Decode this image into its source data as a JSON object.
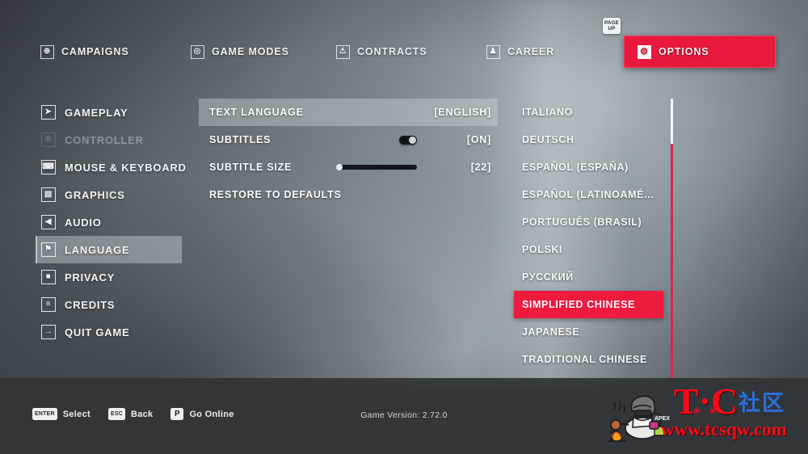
{
  "topnav": {
    "items": [
      {
        "label": "CAMPAIGNS",
        "icon": "globe-icon",
        "glyph": "⊕",
        "active": false
      },
      {
        "label": "GAME MODES",
        "icon": "target-icon",
        "glyph": "◎",
        "active": false
      },
      {
        "label": "CONTRACTS",
        "icon": "warning-icon",
        "glyph": "⚠",
        "active": false
      },
      {
        "label": "CAREER",
        "icon": "person-icon",
        "glyph": "♟",
        "active": false
      },
      {
        "label": "OPTIONS",
        "icon": "gear-icon",
        "glyph": "⚙",
        "active": true
      }
    ],
    "page_key_line1": "PAGE",
    "page_key_line2": "UP"
  },
  "sidebar": {
    "items": [
      {
        "label": "GAMEPLAY",
        "icon": "pistol-icon",
        "glyph": "➤",
        "state": "normal"
      },
      {
        "label": "CONTROLLER",
        "icon": "gamepad-icon",
        "glyph": "✻",
        "state": "disabled"
      },
      {
        "label": "MOUSE & KEYBOARD",
        "icon": "keyboard-icon",
        "glyph": "⌨",
        "state": "normal"
      },
      {
        "label": "GRAPHICS",
        "icon": "monitor-icon",
        "glyph": "▤",
        "state": "normal"
      },
      {
        "label": "AUDIO",
        "icon": "speaker-icon",
        "glyph": "◀",
        "state": "normal"
      },
      {
        "label": "LANGUAGE",
        "icon": "flag-icon",
        "glyph": "⚑",
        "state": "selected"
      },
      {
        "label": "PRIVACY",
        "icon": "lock-icon",
        "glyph": "■",
        "state": "normal"
      },
      {
        "label": "CREDITS",
        "icon": "list-icon",
        "glyph": "≡",
        "state": "normal"
      },
      {
        "label": "QUIT GAME",
        "icon": "exit-icon",
        "glyph": "→",
        "state": "normal"
      }
    ]
  },
  "settings": {
    "rows": [
      {
        "label": "TEXT LANGUAGE",
        "value": "[ENGLISH]",
        "control": "none",
        "highlight": true
      },
      {
        "label": "SUBTITLES",
        "value": "[ON]",
        "control": "toggle",
        "highlight": false
      },
      {
        "label": "SUBTITLE SIZE",
        "value": "[22]",
        "control": "slider",
        "highlight": false
      },
      {
        "label": "RESTORE TO DEFAULTS",
        "value": "",
        "control": "none",
        "highlight": false
      }
    ]
  },
  "languages": {
    "items": [
      {
        "label": "ITALIANO",
        "selected": false
      },
      {
        "label": "DEUTSCH",
        "selected": false
      },
      {
        "label": "ESPAÑOL (ESPAÑA)",
        "selected": false
      },
      {
        "label": "ESPAÑOL (LATINOAMÉ...",
        "selected": false
      },
      {
        "label": "PORTUGUÊS (BRASIL)",
        "selected": false
      },
      {
        "label": "POLSKI",
        "selected": false
      },
      {
        "label": "РУССКИЙ",
        "selected": false
      },
      {
        "label": "SIMPLIFIED CHINESE",
        "selected": true
      },
      {
        "label": "JAPANESE",
        "selected": false
      },
      {
        "label": "TRADITIONAL CHINESE",
        "selected": false
      }
    ]
  },
  "bottombar": {
    "hints": [
      {
        "key": "ENTER",
        "label": "Select",
        "icon": "enter-key-icon"
      },
      {
        "key": "ESC",
        "label": "Back",
        "icon": "esc-key-icon"
      },
      {
        "key": "P",
        "label": "Go Online",
        "icon": "p-key-icon"
      }
    ],
    "version": "Game Version: 2.72.0"
  },
  "watermark": {
    "brand": "T·C",
    "brand_cn": "社区",
    "url": "www.tcsqw.com"
  },
  "colors": {
    "accent_red": "#e8193c",
    "selected_red": "#ee1b3e",
    "scrollbar_red": "#d9264a",
    "watermark_red": "#f60b18",
    "watermark_blue": "#2a6fd8"
  }
}
